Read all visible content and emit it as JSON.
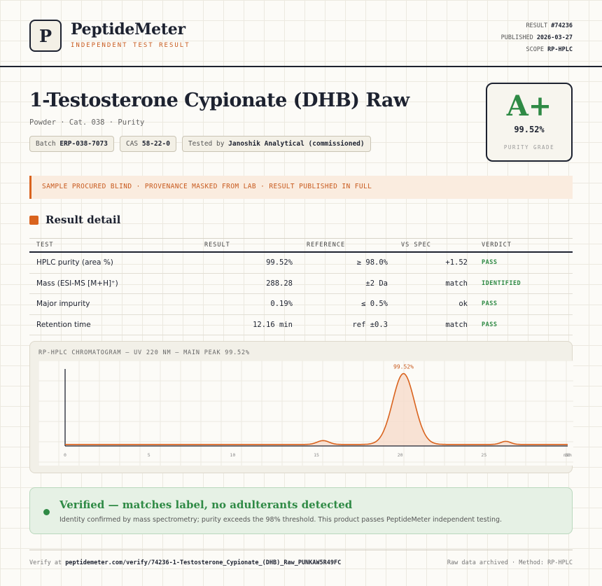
{
  "header": {
    "logo_letter": "P",
    "brand": "PeptideMeter",
    "brand_sub": "INDEPENDENT TEST RESULT",
    "result_label": "RESULT",
    "result_value": "#74236",
    "published_label": "PUBLISHED",
    "published_value": "2026-03-27",
    "scope_label": "SCOPE",
    "scope_value": "RP-HPLC"
  },
  "product": {
    "title": "1-Testosterone Cypionate (DHB) Raw",
    "subtitle": "Powder · Cat. 038 · Purity",
    "batch_label": "Batch",
    "batch_value": "ERP-038-7073",
    "cas_label": "CAS",
    "cas_value": "58-22-0",
    "tested_label": "Tested by",
    "tested_value": "Janoshik Analytical (commissioned)"
  },
  "grade": {
    "letter": "A+",
    "percent": "99.52%",
    "label": "PURITY GRADE",
    "color": "#2f8a45"
  },
  "notice": "SAMPLE PROCURED BLIND · PROVENANCE MASKED FROM LAB · RESULT PUBLISHED IN FULL",
  "section_title": "Result detail",
  "table": {
    "headers": [
      "TEST",
      "RESULT",
      "REFERENCE",
      "VS SPEC",
      "VERDICT"
    ],
    "rows": [
      {
        "test": "HPLC purity (area %)",
        "result": "99.52%",
        "reference": "≥ 98.0%",
        "vs_spec": "+1.52",
        "verdict": "PASS"
      },
      {
        "test": "Mass (ESI-MS [M+H]⁺)",
        "result": "288.28",
        "reference": "±2 Da",
        "vs_spec": "match",
        "verdict": "IDENTIFIED"
      },
      {
        "test": "Major impurity",
        "result": "0.19%",
        "reference": "≤ 0.5%",
        "vs_spec": "ok",
        "verdict": "PASS"
      },
      {
        "test": "Retention time",
        "result": "12.16 min",
        "reference": "ref ±0.3",
        "vs_spec": "match",
        "verdict": "PASS"
      }
    ]
  },
  "chromatogram": {
    "title": "RP-HPLC CHROMATOGRAM — UV 220 NM — MAIN PEAK 99.52%"
  },
  "chart_data": {
    "type": "line",
    "title": "RP-HPLC CHROMATOGRAM — UV 220 NM — MAIN PEAK 99.52%",
    "xlabel": "",
    "ylabel": "",
    "x_ticks": [
      0,
      5,
      10,
      15,
      20,
      25,
      30
    ],
    "x_tick_labels": [
      "0",
      "5",
      "10",
      "15",
      "20",
      "25",
      "30"
    ],
    "x_end_label": "min",
    "xlim": [
      0,
      30
    ],
    "ylim": [
      0,
      100
    ],
    "baseline": 2,
    "peaks": [
      {
        "center": 15.4,
        "height": 5,
        "width": 0.35
      },
      {
        "center": 20.2,
        "height": 92,
        "width": 0.65,
        "label": "99.52%"
      },
      {
        "center": 26.3,
        "height": 4,
        "width": 0.3
      }
    ],
    "line_color": "#d9631e",
    "fill_color": "#f6dccb",
    "grid": true
  },
  "verified": {
    "title": "Verified — matches label, no adulterants detected",
    "text": "Identity confirmed by mass spectrometry; purity exceeds the 98% threshold. This product passes PeptideMeter independent testing."
  },
  "footer": {
    "verify_label": "Verify at",
    "verify_url": "peptidemeter.com/verify/74236-1-Testosterone_Cypionate_(DHB)_Raw_PUNKAW5R49FC",
    "right_text": "Raw data archived · Method: RP-HPLC"
  }
}
